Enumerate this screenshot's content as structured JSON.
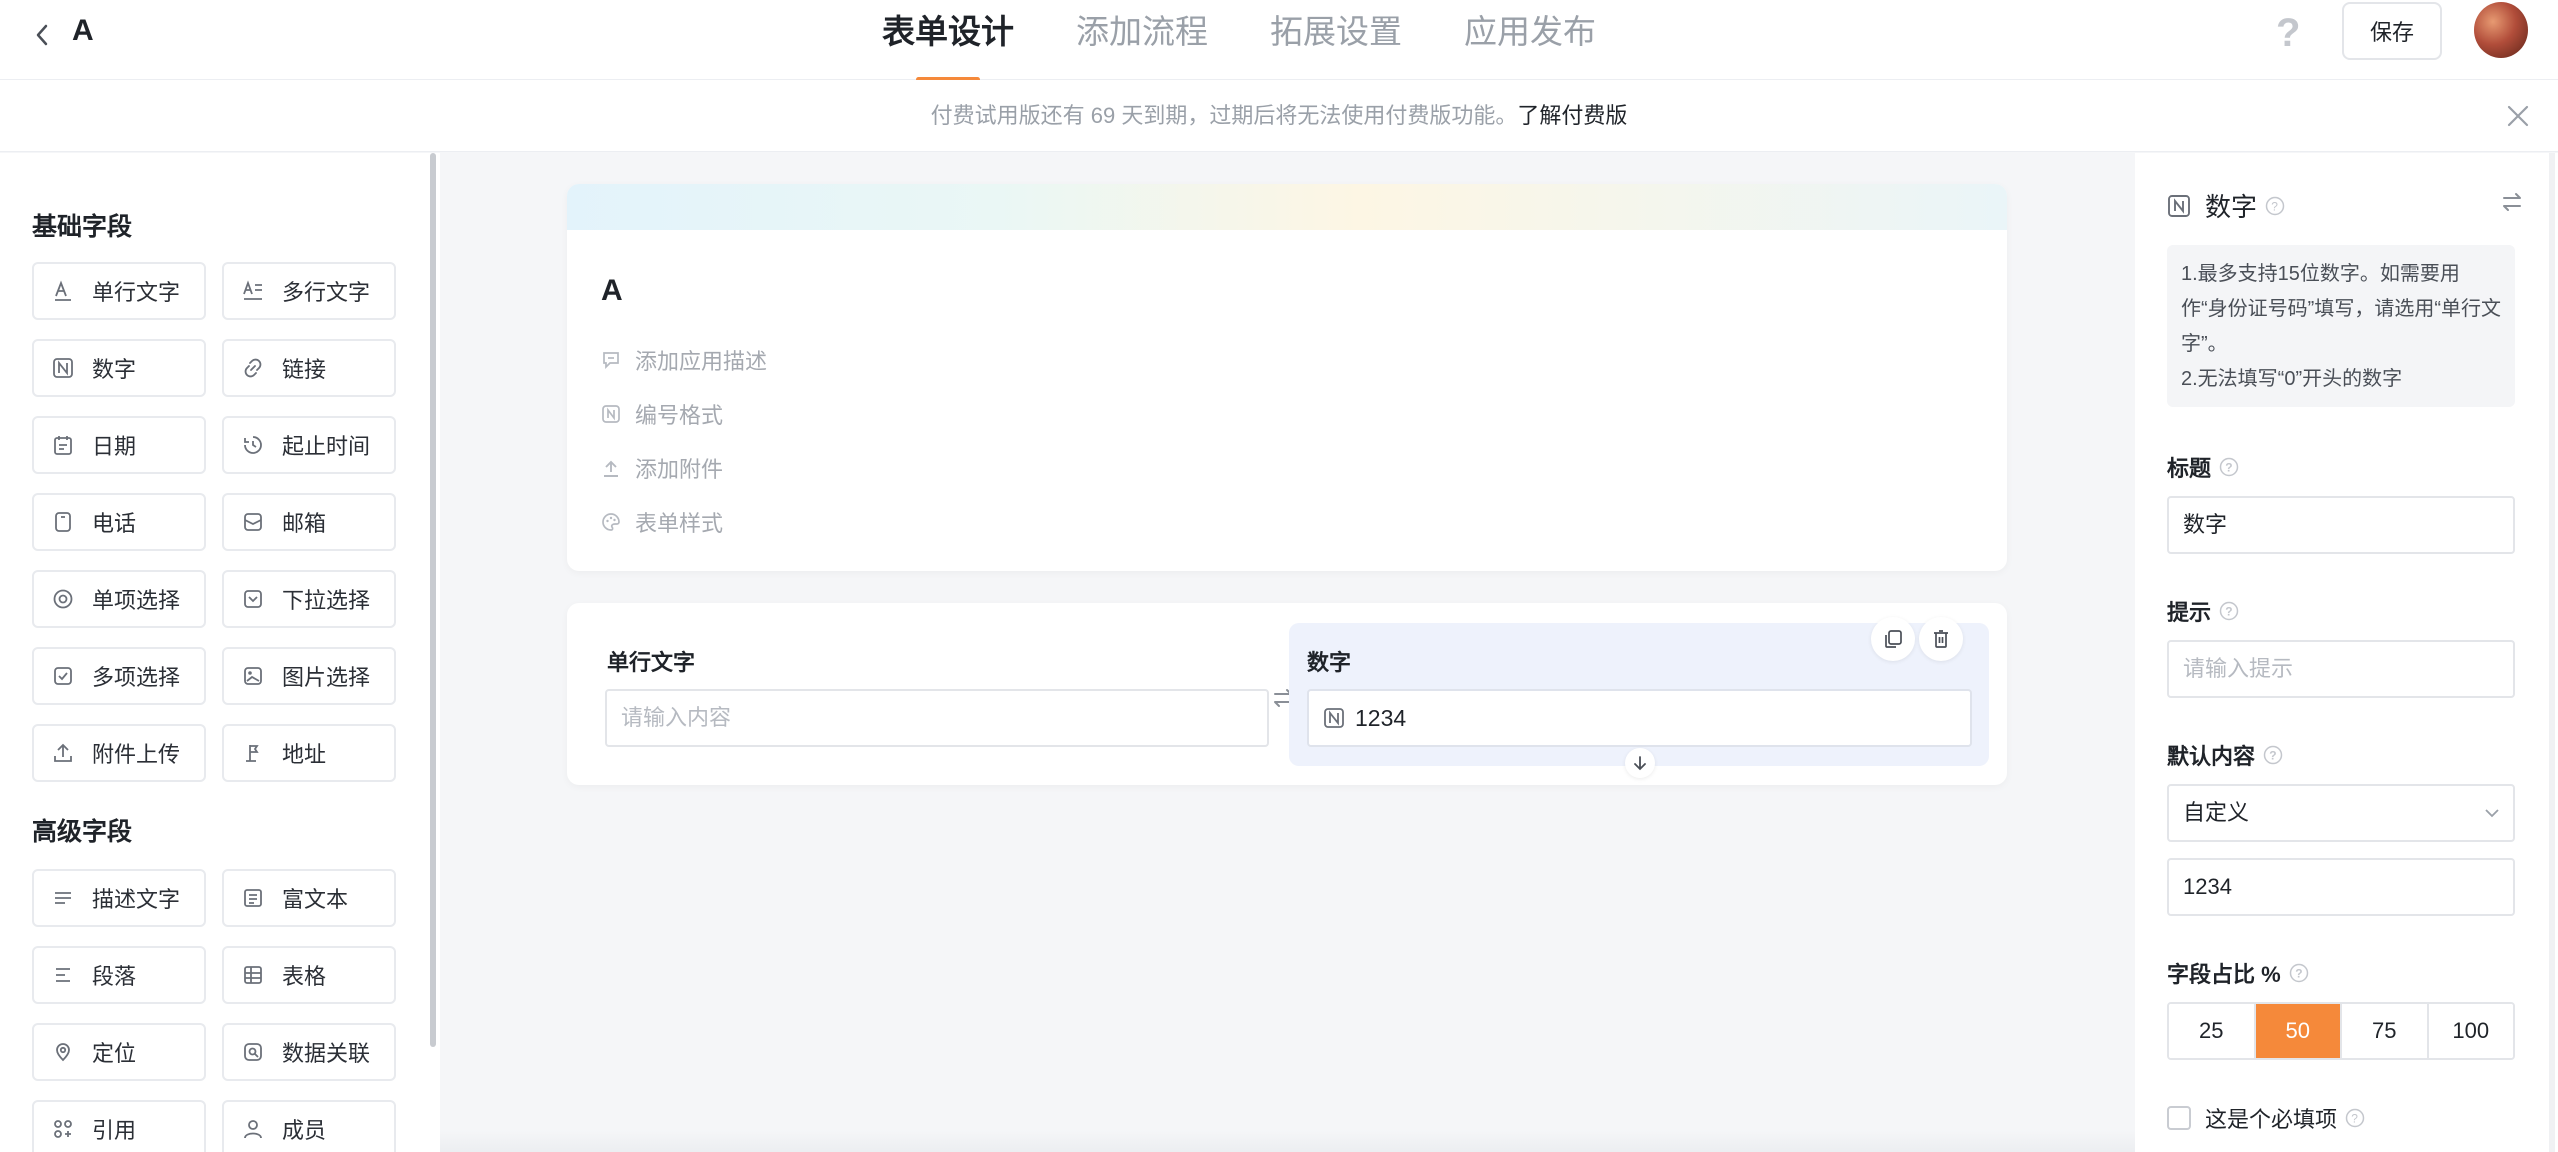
{
  "app": {
    "title": "A"
  },
  "tabs": [
    {
      "label": "表单设计"
    },
    {
      "label": "添加流程"
    },
    {
      "label": "拓展设置"
    },
    {
      "label": "应用发布"
    }
  ],
  "header": {
    "save_label": "保存"
  },
  "notice": {
    "text": "付费试用版还有 69 天到期，过期后将无法使用付费版功能。",
    "link": "了解付费版"
  },
  "palette": {
    "basic_title": "基础字段",
    "basic": [
      {
        "label": "单行文字",
        "icon": "single-line-text-icon"
      },
      {
        "label": "多行文字",
        "icon": "multi-line-text-icon"
      },
      {
        "label": "数字",
        "icon": "number-icon"
      },
      {
        "label": "链接",
        "icon": "link-icon"
      },
      {
        "label": "日期",
        "icon": "calendar-icon"
      },
      {
        "label": "起止时间",
        "icon": "time-range-icon"
      },
      {
        "label": "电话",
        "icon": "phone-icon"
      },
      {
        "label": "邮箱",
        "icon": "mail-icon"
      },
      {
        "label": "单项选择",
        "icon": "radio-icon"
      },
      {
        "label": "下拉选择",
        "icon": "dropdown-icon"
      },
      {
        "label": "多项选择",
        "icon": "checkbox-icon"
      },
      {
        "label": "图片选择",
        "icon": "image-icon"
      },
      {
        "label": "附件上传",
        "icon": "upload-icon"
      },
      {
        "label": "地址",
        "icon": "address-icon"
      }
    ],
    "advanced_title": "高级字段",
    "advanced": [
      {
        "label": "描述文字",
        "icon": "description-icon"
      },
      {
        "label": "富文本",
        "icon": "rich-text-icon"
      },
      {
        "label": "段落",
        "icon": "paragraph-icon"
      },
      {
        "label": "表格",
        "icon": "table-icon"
      },
      {
        "label": "定位",
        "icon": "location-icon"
      },
      {
        "label": "数据关联",
        "icon": "data-link-icon"
      },
      {
        "label": "引用",
        "icon": "reference-icon"
      },
      {
        "label": "成员",
        "icon": "member-icon"
      }
    ]
  },
  "canvas": {
    "form_title": "A",
    "meta": [
      {
        "label": "添加应用描述",
        "icon": "comment-icon"
      },
      {
        "label": "编号格式",
        "icon": "number-format-icon"
      },
      {
        "label": "添加附件",
        "icon": "upload-icon"
      },
      {
        "label": "表单样式",
        "icon": "palette-icon"
      }
    ],
    "field1": {
      "label": "单行文字",
      "placeholder": "请输入内容"
    },
    "field2": {
      "label": "数字",
      "value": "1234"
    }
  },
  "props": {
    "title": "数字",
    "tip_lines": [
      "1.最多支持15位数字。如需要用作“身份证号码”填写，请选用“单行文字”。",
      "2.无法填写“0”开头的数字"
    ],
    "title_label": "标题",
    "title_value": "数字",
    "hint_label": "提示",
    "hint_placeholder": "请输入提示",
    "default_label": "默认内容",
    "default_mode": "自定义",
    "default_value": "1234",
    "ratio_label": "字段占比 %",
    "ratio_options": [
      "25",
      "50",
      "75",
      "100"
    ],
    "ratio_selected": "50",
    "required_label": "这是个必填项"
  },
  "colors": {
    "accent": "#f5893a",
    "selected_field_bg": "#eef2fc"
  }
}
